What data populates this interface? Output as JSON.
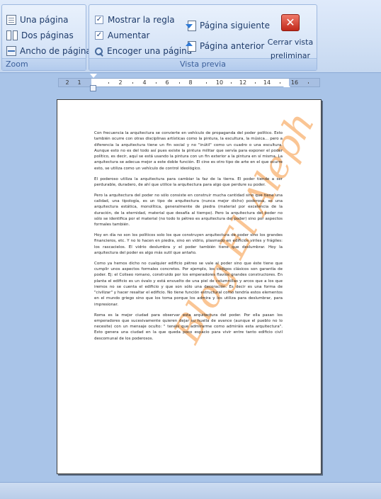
{
  "ribbon": {
    "zoom_group": {
      "label": "Zoom",
      "buttons": [
        "Una página",
        "Dos páginas",
        "Ancho de página"
      ]
    },
    "preview_group": {
      "label": "Vista previa",
      "show_ruler": {
        "label": "Mostrar la regla",
        "checked": true
      },
      "magnifier": {
        "label": "Aumentar",
        "checked": true
      },
      "shrink_one_page": "Encoger una página",
      "next_page": "Página siguiente",
      "previous_page": "Página anterior",
      "close_preview": "Cerrar vista preliminar"
    }
  },
  "ruler": {
    "ticks": [
      "2",
      "1",
      "2",
      "4",
      "6",
      "8",
      "10",
      "12",
      "14",
      "16"
    ]
  },
  "document": {
    "watermark": "Blog El Aleph",
    "paragraphs": [
      "Con frecuencia la arquitectura se convierte en vehículo de propaganda del poder político. Esto también ocurre con otras disciplinas artísticas como la pintura, la escultura, la música... pero a diferencia la arquitectura tiene un fin social y no \"inútil\" como un cuadro o una escultura. Aunque esto no es del todo así pues existe la pintura militar que servía para exponer el poder político, es decir, aquí se está usando la pintura con un fin exterior a la pintura en sí misma. La arquitectura se adecua mejor a este doble función. El cine es otro tipo de arte en el que ocurre esto, se utiliza como un vehículo de control ideológico.",
      "El poderoso utiliza la arquitectura para cambiar la faz de la tierra. El poder tiende a ser perdurable, duradero, de ahí que utilice la arquitectura para algo que perdure su poder.",
      "Pero la arquitectura del poder no sólo consiste en construir mucha cantidad sino que tiene una calidad, una tipología, es un tipo de arquitectura (nunca mejor dicho) poderosa, es una arquitectura estática, monolítica, generalmente de piedra (material por excelencia de la duración, de la eternidad, material que desafía al tiempo). Pero la arquitectura del poder no sólo se identifica por el material (no todo lo pétreo es arquitectura del poder) sino por aspectos formales también.",
      "Hoy en día no son los políticos solo los que construyen arquitectura de poder sino los grandes financieros, etc. Y no lo hacen en piedra, sino en vidrio, plasmado en edificios viriles y frágiles: los rascacielos. El vidrio deslumbra y el poder también tiene que deslumbrar. Hoy la arquitectura del poder es algo más sutil que antaño.",
      "Como ya hemos dicho no cualquier edificio pétreo se vale al poder sino que éste tiene que cumplir unos aspectos formales concretos. Por ejemplo, los códigos clásicos son garantía de poder. Ej: el Coliseo romano, construido por los emperadores flavios grandes constructores. En planta el edificio es un óvalo y está envuelto de una piel de columnillas y arcos que a los que iremos no se cuenta el edificio y que son sólo una decoración. Es decir es una forma de \"civilizar\" y hacer resaltar el edificio. No tiene función estructural como tendría estos elementos en el mundo griego sino que los toma porque los admira y los utiliza para deslumbrar, para impresionar.",
      "Roma es la mejor ciudad para observar esta arquitectura del poder. Por ella pasan los emperadores que sucesivamente quieren dejar su huella de avance (aunque el pueblo no lo necesite) con un mensaje oculto: \" tenéis que admirarme como admiráis esta arquitectura\". Esto genera una ciudad en la que queda poco espacio para vivir entre tanto edificio civil descomunal de los poderosos."
    ]
  }
}
